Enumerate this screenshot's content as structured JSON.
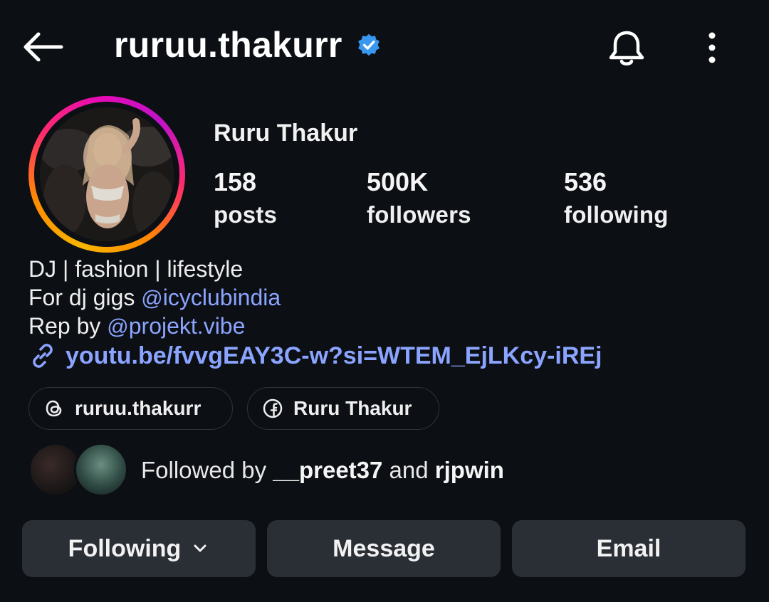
{
  "header": {
    "handle": "ruruu.thakurr",
    "verified": true
  },
  "profile": {
    "full_name": "Ruru Thakur",
    "stats": [
      {
        "value": "158",
        "label": "posts"
      },
      {
        "value": "500K",
        "label": "followers"
      },
      {
        "value": "536",
        "label": "following"
      }
    ]
  },
  "bio": {
    "line1": "DJ | fashion | lifestyle",
    "line2_prefix": "For dj gigs ",
    "line2_mention": "icyclubindia",
    "line3_prefix": "Rep by ",
    "line3_mention": "projekt.vibe",
    "link": "youtu.be/fvvgEAY3C-w?si=WTEM_EjLKcy-iREj"
  },
  "chips": {
    "threads": "ruruu.thakurr",
    "facebook": "Ruru Thakur"
  },
  "followed_by": {
    "prefix": "Followed by ",
    "user1": "__preet37",
    "conjunction": " and ",
    "user2": "rjpwin"
  },
  "actions": {
    "following": "Following",
    "message": "Message",
    "email": "Email"
  },
  "colors": {
    "background": "#0c0f14",
    "link": "#8aa4ff",
    "verified": "#3897f0",
    "button": "#2a2e35"
  }
}
